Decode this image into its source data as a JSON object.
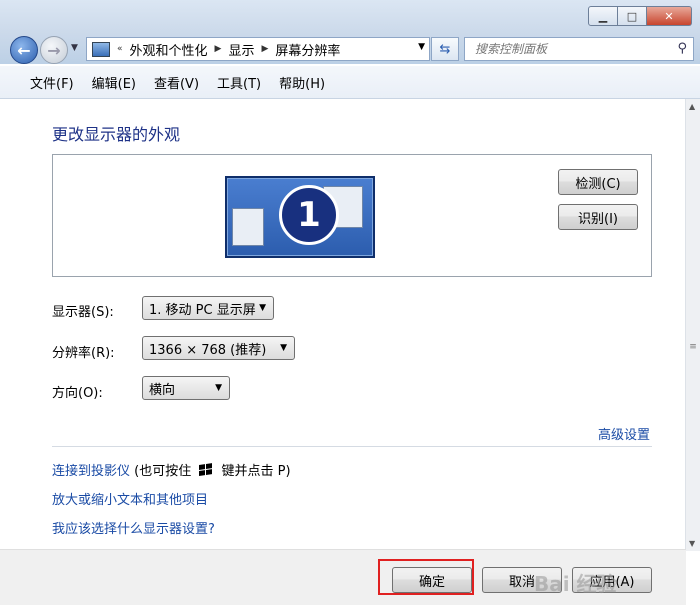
{
  "window": {
    "minimize_glyph": "▁",
    "maximize_glyph": "□",
    "close_glyph": "✕"
  },
  "address_bar": {
    "overflow": "«",
    "crumbs": [
      "外观和个性化",
      "显示",
      "屏幕分辨率"
    ],
    "search_placeholder": "搜索控制面板"
  },
  "menu": [
    "文件(F)",
    "编辑(E)",
    "查看(V)",
    "工具(T)",
    "帮助(H)"
  ],
  "page": {
    "title": "更改显示器的外观",
    "monitor_number": "1",
    "detect_button": "检测(C)",
    "identify_button": "识别(I)"
  },
  "fields": {
    "display": {
      "label": "显示器(S):",
      "value": "1. 移动 PC 显示屏"
    },
    "resolution": {
      "label": "分辨率(R):",
      "value": "1366 × 768 (推荐)"
    },
    "orientation": {
      "label": "方向(O):",
      "value": "横向"
    }
  },
  "advanced_link": "高级设置",
  "links": {
    "projector": "连接到投影仪",
    "projector_hint_pre": "(也可按住",
    "projector_hint_post": "键并点击 P)",
    "text_size": "放大或缩小文本和其他项目",
    "which_settings": "我应该选择什么显示器设置?"
  },
  "buttons": {
    "ok": "确定",
    "cancel": "取消",
    "apply": "应用(A)"
  },
  "watermark": "Bai  经验",
  "colors": {
    "title_blue": "#1e3287",
    "link_blue": "#1a4ba5",
    "highlight_red": "#e02020"
  }
}
